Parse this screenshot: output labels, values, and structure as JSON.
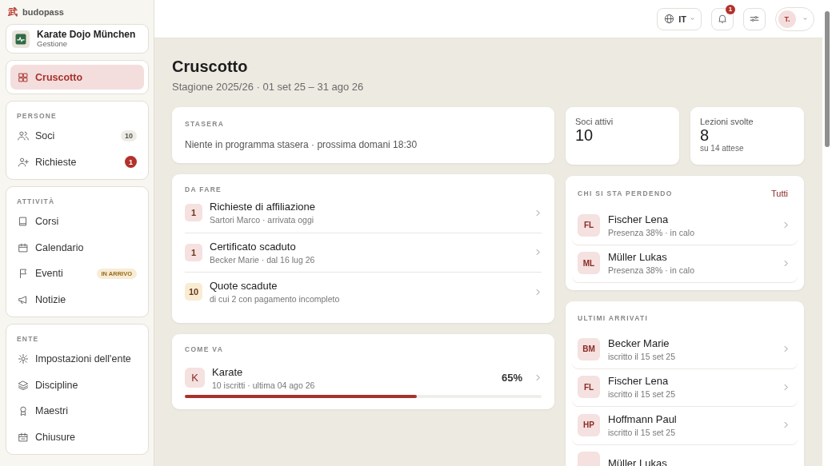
{
  "brand": {
    "name": "budopass",
    "logo": "武"
  },
  "org": {
    "name": "Karate Dojo München",
    "role": "Gestione"
  },
  "sidebar": [
    {
      "items": [
        {
          "label": "Cruscotto",
          "selected": true
        }
      ]
    },
    {
      "heading": "PERSONE",
      "items": [
        {
          "label": "Soci",
          "selected": false,
          "badge": {
            "kind": "count",
            "text": "10"
          }
        },
        {
          "label": "Richieste",
          "selected": false,
          "badge": {
            "kind": "alert",
            "text": "1"
          }
        }
      ]
    },
    {
      "heading": "ATTIVITÀ",
      "items": [
        {
          "label": "Corsi",
          "selected": false
        },
        {
          "label": "Calendario",
          "selected": false
        },
        {
          "label": "Eventi",
          "selected": false,
          "badge": {
            "kind": "tag",
            "text": "IN ARRIVO"
          }
        },
        {
          "label": "Notizie",
          "selected": false
        }
      ]
    },
    {
      "heading": "ENTE",
      "items": [
        {
          "label": "Impostazioni dell'ente",
          "selected": false
        },
        {
          "label": "Discipline",
          "selected": false
        },
        {
          "label": "Maestri",
          "selected": false
        },
        {
          "label": "Chiusure",
          "selected": false
        }
      ]
    }
  ],
  "topbar": {
    "language": "IT",
    "notifications": "1",
    "avatar": "T."
  },
  "page": {
    "title": "Cruscotto",
    "subtitle": "Stagione 2025/26 · 01 set 25 – 31 ago 26"
  },
  "tonight": {
    "heading": "STASERA",
    "text": "Niente in programma stasera · prossima domani 18:30"
  },
  "stats": [
    {
      "label": "Soci attivi",
      "value": "10"
    },
    {
      "label": "Lezioni svolte",
      "value": "8",
      "note": "su 14 attese"
    }
  ],
  "todo": {
    "heading": "DA FARE",
    "items": [
      {
        "count": "1",
        "color": "#f6e1e0",
        "title": "Richieste di affiliazione",
        "detail": "Sartori Marco · arrivata oggi"
      },
      {
        "count": "1",
        "color": "#f6e1e0",
        "title": "Certificato scaduto",
        "detail": "Becker Marie · dal 16 lug 26"
      },
      {
        "count": "10",
        "color": "#f8ecd3",
        "title": "Quote scadute",
        "detail": "di cui 2 con pagamento incompleto"
      }
    ]
  },
  "progress": {
    "heading": "COME VA",
    "items": [
      {
        "initial": "K",
        "name": "Karate",
        "detail": "10 iscritti · ultima 04 ago 26",
        "percent": "65%",
        "level": 0.65
      }
    ]
  },
  "at_risk": {
    "heading": "CHI SI STA PERDENDO",
    "link": "Tutti",
    "people": [
      {
        "initials": "FL",
        "name": "Fischer Lena",
        "detail": "Presenza 38% · in calo"
      },
      {
        "initials": "ML",
        "name": "Müller Lukas",
        "detail": "Presenza 38% · in calo"
      }
    ]
  },
  "arrivals": {
    "heading": "ULTIMI ARRIVATI",
    "people": [
      {
        "initials": "BM",
        "name": "Becker Marie",
        "detail": "iscritto il 15 set 25"
      },
      {
        "initials": "FL",
        "name": "Fischer Lena",
        "detail": "iscritto il 15 set 25"
      },
      {
        "initials": "HP",
        "name": "Hoffmann Paul",
        "detail": "iscritto il 15 set 25"
      },
      {
        "name": "Müller Lukas"
      }
    ]
  }
}
